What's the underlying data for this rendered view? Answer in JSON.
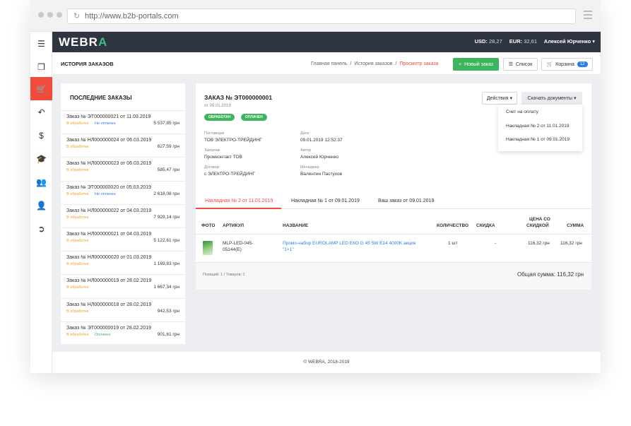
{
  "browser": {
    "url": "http://www.b2b-portals.com"
  },
  "topbar": {
    "logo_main": "WEBR",
    "logo_accent": "A",
    "usd_label": "USD:",
    "usd_value": "28,27",
    "eur_label": "EUR:",
    "eur_value": "32,61",
    "user_name": "Алексей Юрченко ▾"
  },
  "subheader": {
    "title": "ИСТОРИЯ ЗАКАЗОВ",
    "breadcrumbs": [
      "Главная панель",
      "История заказов",
      "Просмотр заказа"
    ],
    "new_order_label": "Новый заказ",
    "list_label": "Список",
    "cart_label": "Корзина",
    "cart_count": "12"
  },
  "sidebar": {
    "icons": [
      "menu-icon",
      "catalog-icon",
      "cart-icon",
      "return-icon",
      "dollar-icon",
      "education-icon",
      "users-icon",
      "user-settings-icon",
      "logout-icon"
    ]
  },
  "recent_orders": {
    "title": "ПОСЛЕДНИЕ ЗАКАЗЫ",
    "items": [
      {
        "number": "Заказ № ЭТ000000021 от 11.03.2019",
        "status": "В обработке",
        "payment": "Не оплачен",
        "sum": "5 537,85 грн"
      },
      {
        "number": "Заказ № НЛ000000024 от 06.03.2019",
        "status": "В обработке",
        "payment": "",
        "sum": "627,59 грн"
      },
      {
        "number": "Заказ № НЛ000000023 от 06.03.2019",
        "status": "В обработке",
        "payment": "",
        "sum": "585,47 грн"
      },
      {
        "number": "Заказ № ЭТ000000020 от 05.03.2019",
        "status": "В обработке",
        "payment": "Не оплачен",
        "sum": "2 618,08 грн"
      },
      {
        "number": "Заказ № НЛ000000022 от 04.03.2019",
        "status": "В обработке",
        "payment": "",
        "sum": "7 929,14 грн"
      },
      {
        "number": "Заказ № НЛ000000021 от 04.03.2019",
        "status": "В обработке",
        "payment": "",
        "sum": "5 122,61 грн"
      },
      {
        "number": "Заказ № НЛ000000020 от 01.03.2019",
        "status": "В обработке",
        "payment": "",
        "sum": "1 169,83 грн"
      },
      {
        "number": "Заказ № НЛ000000019 от 28.02.2019",
        "status": "В обработке",
        "payment": "",
        "sum": "1 667,34 грн"
      },
      {
        "number": "Заказ № НЛ000000018 от 28.02.2019",
        "status": "В обработке",
        "payment": "",
        "sum": "942,53 грн"
      },
      {
        "number": "Заказ № ЭТ000000019 от 28.02.2019",
        "status": "В обработке",
        "payment": "Оплачен",
        "sum": "901,61 грн"
      }
    ]
  },
  "order": {
    "title": "ЗАКАЗ № ЭТ000000001",
    "date": "от 09.01.2019",
    "chip_processed": "ОБРАБОТАН",
    "chip_paid": "ОПЛАЧЕН",
    "supplier_label": "Поставщик",
    "supplier": "ТОВ ЭЛЕКТРО-ТРЕЙДИНГ",
    "date_label": "Дата",
    "datetime": "09.01.2019 12:52:37",
    "customer_label": "Заказчик",
    "customer": "Промконтакт ТОВ",
    "author_label": "Автор",
    "author": "Алексей Юрченко",
    "contract_label": "Договор",
    "contract": "с ЭЛЕКТРО-ТРЕЙДИНГ",
    "manager_label": "Менеджер",
    "manager": "Валентин Пастухов",
    "actions_label": "Действия ▾",
    "download_label": "Скачать документы ▾",
    "dropdown": [
      "Счет на оплату",
      "Накладная № 2 от 11.01.2019",
      "Накладная № 1 от 09.01.2019"
    ],
    "tabs": [
      "Накладная № 2 от 11.01.2019",
      "Накладная № 1 от 09.01.2019",
      "Ваш заказ от 09.01.2019"
    ],
    "columns": {
      "photo": "ФОТО",
      "article": "АРТИКУЛ",
      "name": "НАЗВАНИЕ",
      "qty": "КОЛИЧЕСТВО",
      "discount": "СКИДКА",
      "price_line1": "ЦЕНА СО",
      "price_line2": "СКИДКОЙ",
      "sum": "СУММА"
    },
    "row": {
      "article_line1": "MLP-LED-045-",
      "article_line2": "05144(E)",
      "name_line1": "Промо-набор EUROLAMP LED ЕКО G 45 5W E14 4000K акция",
      "name_line2": "\"1+1\"",
      "qty": "1 шт",
      "discount": "-",
      "price": "116,32 грн",
      "sum": "116,32 грн"
    },
    "summary_positions": "Позиций: 1 / Товаров: 1",
    "total": "Общая сумма: 116,32 грн"
  },
  "footer": {
    "copyright": "© WEBRA, 2018-2019"
  },
  "colors": {
    "accent": "#f14b3c",
    "green": "#3cb55e",
    "blue": "#2b7de9",
    "dark": "#2e3440"
  }
}
